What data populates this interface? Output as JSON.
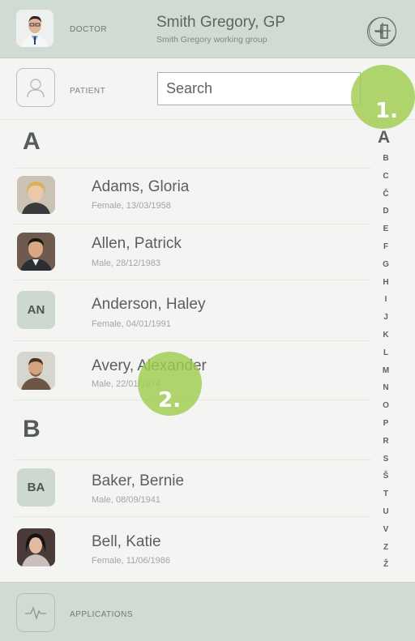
{
  "header": {
    "doctor_label": "DOCTOR",
    "doctor_name": "Smith Gregory, GP",
    "doctor_group": "Smith Gregory working group",
    "logout_icon": "logout-icon"
  },
  "patient_bar": {
    "label": "PATIENT",
    "search_placeholder": "Search",
    "add_icon": "add-circle-icon"
  },
  "markers": {
    "first": "1.",
    "second": "2."
  },
  "sections": [
    {
      "letter": "A",
      "patients": [
        {
          "name": "Adams, Gloria",
          "info": "Female, 13/03/1958",
          "photo": "photo"
        },
        {
          "name": "Allen, Patrick",
          "info": "Male, 28/12/1983",
          "photo": "photo"
        },
        {
          "name": "Anderson, Haley",
          "info": "Female, 04/01/1991",
          "initials": "AN"
        },
        {
          "name": "Avery, Alexander",
          "info": "Male, 22/01/1974",
          "photo": "photo"
        }
      ]
    },
    {
      "letter": "B",
      "patients": [
        {
          "name": "Baker, Bernie",
          "info": "Male, 08/09/1941",
          "initials": "BA"
        },
        {
          "name": "Bell, Katie",
          "info": "Female, 11/06/1986",
          "photo": "photo"
        }
      ]
    }
  ],
  "alphabet": [
    "A",
    "B",
    "C",
    "Č",
    "D",
    "E",
    "F",
    "G",
    "H",
    "I",
    "J",
    "K",
    "L",
    "M",
    "N",
    "O",
    "P",
    "R",
    "S",
    "Š",
    "T",
    "U",
    "V",
    "Z",
    "Ž"
  ],
  "footer": {
    "label": "APPLICATIONS",
    "icon": "heartbeat-icon"
  },
  "colors": {
    "header_bg": "#d0dcd3",
    "marker": "#a0cd50",
    "page_bg": "#f4f4f2"
  }
}
